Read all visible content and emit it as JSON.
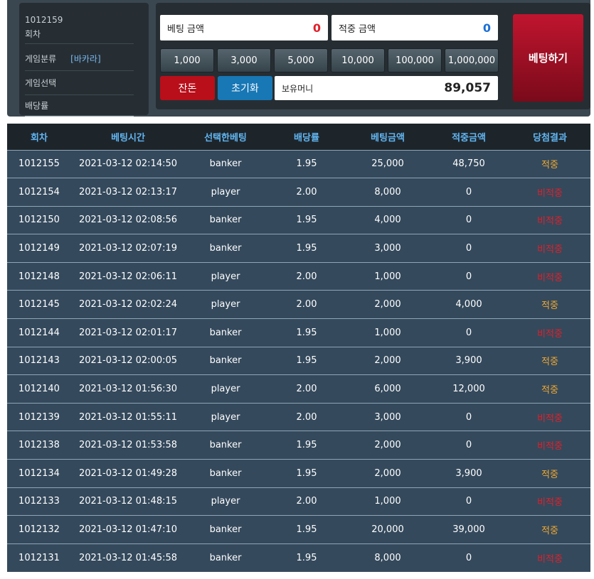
{
  "info": {
    "round_no": "1012159",
    "round_label": "회차",
    "category_label": "게임분류",
    "category_value": "[바카라]",
    "select_label": "게임선택",
    "odds_label": "배당률"
  },
  "bet": {
    "bet_amount_label": "베팅 금액",
    "bet_amount_value": "0",
    "hit_amount_label": "적중 금액",
    "hit_amount_value": "0",
    "chips": [
      "1,000",
      "3,000",
      "5,000",
      "10,000",
      "100,000",
      "1,000,000"
    ],
    "change_label": "잔돈",
    "reset_label": "초기화",
    "money_label": "보유머니",
    "money_value": "89,057",
    "bet_button_label": "베팅하기"
  },
  "colors": {
    "hit": "#f0a830",
    "miss": "#e0202a",
    "header_text": "#62b6f2",
    "bet_button": "#c0152f"
  },
  "table": {
    "columns": [
      "회차",
      "베팅시간",
      "선택한베팅",
      "배당률",
      "베팅금액",
      "적중금액",
      "당첨결과"
    ],
    "rows": [
      [
        "1012155",
        "2021-03-12 02:14:50",
        "banker",
        "1.95",
        "25,000",
        "48,750",
        "적중"
      ],
      [
        "1012154",
        "2021-03-12 02:13:17",
        "player",
        "2.00",
        "8,000",
        "0",
        "비적중"
      ],
      [
        "1012150",
        "2021-03-12 02:08:56",
        "banker",
        "1.95",
        "4,000",
        "0",
        "비적중"
      ],
      [
        "1012149",
        "2021-03-12 02:07:19",
        "banker",
        "1.95",
        "3,000",
        "0",
        "비적중"
      ],
      [
        "1012148",
        "2021-03-12 02:06:11",
        "player",
        "2.00",
        "1,000",
        "0",
        "비적중"
      ],
      [
        "1012145",
        "2021-03-12 02:02:24",
        "player",
        "2.00",
        "2,000",
        "4,000",
        "적중"
      ],
      [
        "1012144",
        "2021-03-12 02:01:17",
        "banker",
        "1.95",
        "1,000",
        "0",
        "비적중"
      ],
      [
        "1012143",
        "2021-03-12 02:00:05",
        "banker",
        "1.95",
        "2,000",
        "3,900",
        "적중"
      ],
      [
        "1012140",
        "2021-03-12 01:56:30",
        "player",
        "2.00",
        "6,000",
        "12,000",
        "적중"
      ],
      [
        "1012139",
        "2021-03-12 01:55:11",
        "player",
        "2.00",
        "3,000",
        "0",
        "비적중"
      ],
      [
        "1012138",
        "2021-03-12 01:53:58",
        "banker",
        "1.95",
        "2,000",
        "0",
        "비적중"
      ],
      [
        "1012134",
        "2021-03-12 01:49:28",
        "banker",
        "1.95",
        "2,000",
        "3,900",
        "적중"
      ],
      [
        "1012133",
        "2021-03-12 01:48:15",
        "player",
        "2.00",
        "1,000",
        "0",
        "비적중"
      ],
      [
        "1012132",
        "2021-03-12 01:47:10",
        "banker",
        "1.95",
        "20,000",
        "39,000",
        "적중"
      ],
      [
        "1012131",
        "2021-03-12 01:45:58",
        "banker",
        "1.95",
        "8,000",
        "0",
        "비적중"
      ]
    ]
  }
}
